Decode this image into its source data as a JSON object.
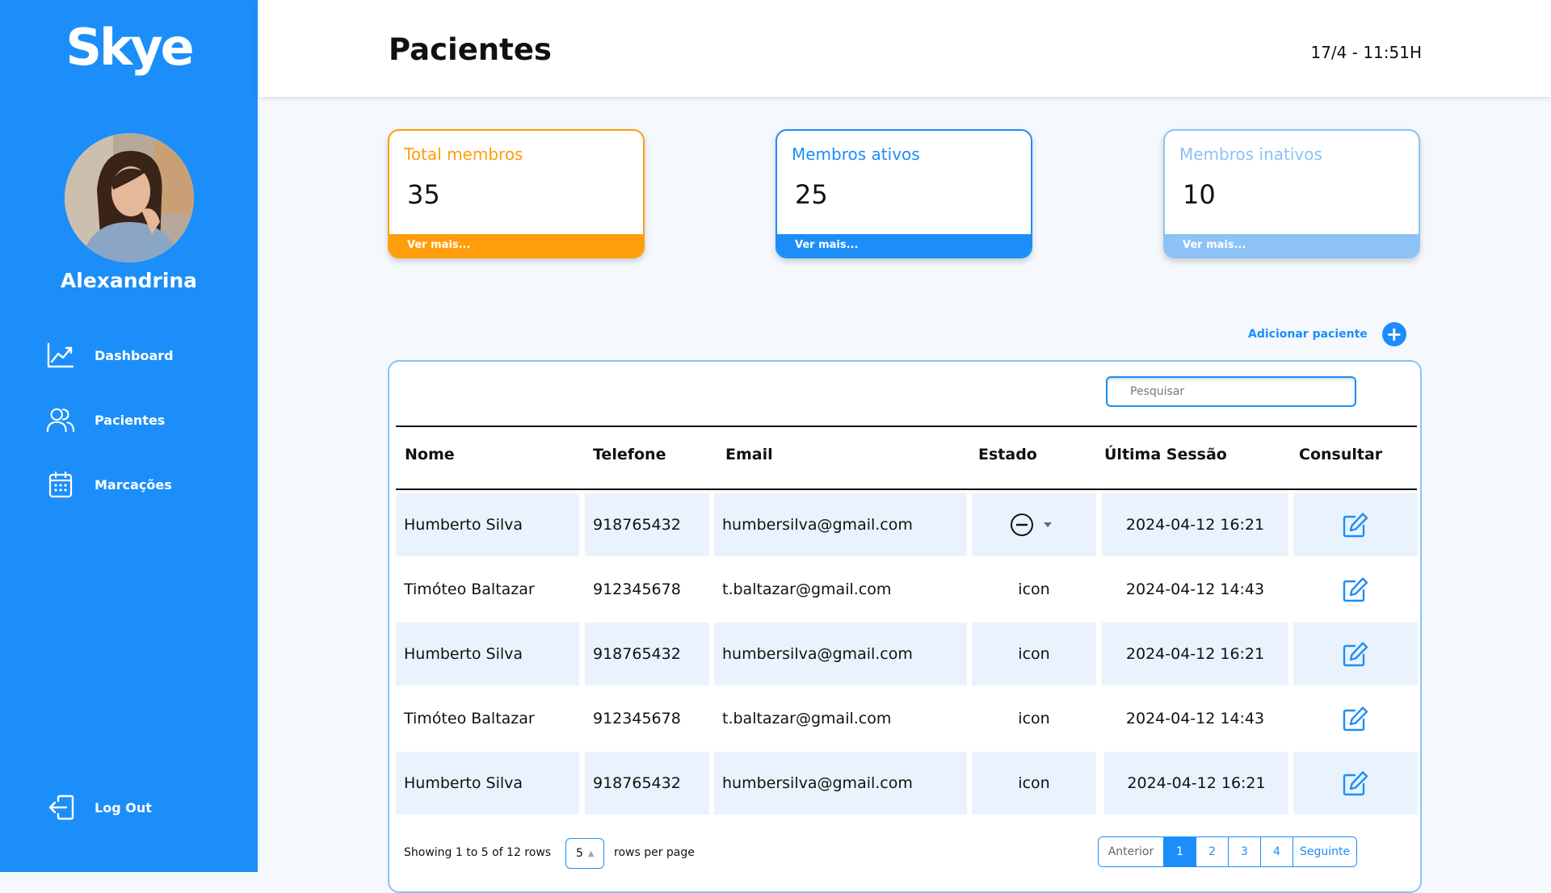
{
  "sidebar": {
    "logo": "Skye",
    "username": "Alexandrina",
    "nav": [
      {
        "label": "Dashboard",
        "icon": "chart-line-icon"
      },
      {
        "label": "Pacientes",
        "icon": "users-icon"
      },
      {
        "label": "Marcações",
        "icon": "calendar-icon"
      }
    ],
    "logout": {
      "label": "Log Out",
      "icon": "logout-icon"
    }
  },
  "header": {
    "title": "Pacientes",
    "datetime": "17/4 - 11:51H"
  },
  "cards": [
    {
      "title": "Total membros",
      "value": "35",
      "footer": "Ver mais...",
      "color": "#ff9d0a"
    },
    {
      "title": "Membros ativos",
      "value": "25",
      "footer": "Ver mais...",
      "color": "#1c8ef9"
    },
    {
      "title": "Membros inativos",
      "value": "10",
      "footer": "Ver mais...",
      "color": "#8cc2f5"
    }
  ],
  "add_patient": {
    "label": "Adicionar paciente"
  },
  "table": {
    "search_placeholder": "Pesquisar",
    "headers": [
      "Nome",
      "Telefone",
      "Email",
      "Estado",
      "Última Sessão",
      "Consultar"
    ],
    "rows": [
      {
        "nome": "Humberto Silva",
        "telefone": "918765432",
        "email": "humbersilva@gmail.com",
        "estado": "",
        "estado_icon": "minus-circle-dropdown",
        "sessao": "2024-04-12 16:21"
      },
      {
        "nome": "Timóteo Baltazar",
        "telefone": "912345678",
        "email": "t.baltazar@gmail.com",
        "estado": "icon",
        "sessao": "2024-04-12 14:43"
      },
      {
        "nome": "Humberto Silva",
        "telefone": "918765432",
        "email": "humbersilva@gmail.com",
        "estado": "icon",
        "sessao": "2024-04-12 16:21"
      },
      {
        "nome": "Timóteo Baltazar",
        "telefone": "912345678",
        "email": "t.baltazar@gmail.com",
        "estado": "icon",
        "sessao": "2024-04-12 14:43"
      },
      {
        "nome": "Humberto Silva",
        "telefone": "918765432",
        "email": "humbersilva@gmail.com",
        "estado": "icon",
        "sessao": "2024-04-12 16:21"
      }
    ],
    "footer": {
      "showing": "Showing 1 to 5 of 12 rows",
      "rows_per_page_value": "5",
      "rows_per_page_label": "rows per page",
      "prev": "Anterior",
      "pages": [
        "1",
        "2",
        "3",
        "4"
      ],
      "active_page": "1",
      "next": "Seguinte"
    }
  },
  "colors": {
    "accent": "#1c8ef9",
    "orange": "#ff9d0a",
    "light_blue": "#8cc2f5",
    "row_shade": "#eaf3fd"
  }
}
